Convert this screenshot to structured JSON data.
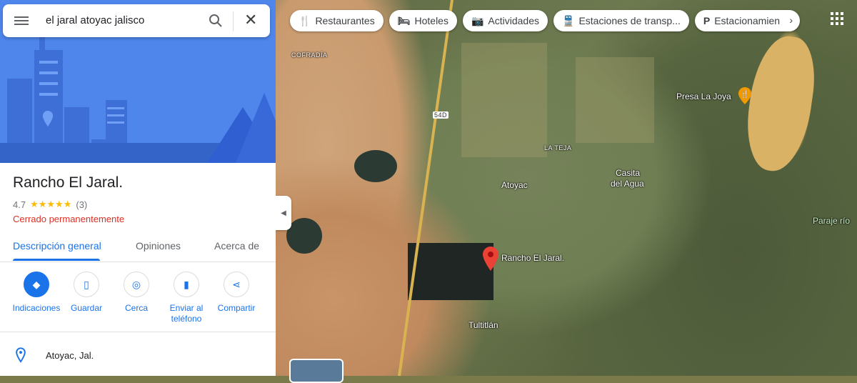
{
  "search": {
    "query": "el jaral atoyac jalisco"
  },
  "place": {
    "title": "Rancho El Jaral.",
    "rating": "4.7",
    "review_count": "(3)",
    "stars": "★★★★★",
    "status": "Cerrado permanentemente",
    "address": "Atoyac, Jal."
  },
  "tabs": [
    {
      "label": "Descripción general"
    },
    {
      "label": "Opiniones"
    },
    {
      "label": "Acerca de"
    }
  ],
  "actions": [
    {
      "label": "Indicaciones",
      "icon": "directions-icon"
    },
    {
      "label": "Guardar",
      "icon": "bookmark-icon"
    },
    {
      "label": "Cerca",
      "icon": "nearby-icon"
    },
    {
      "label": "Enviar al teléfono",
      "icon": "send-to-phone-icon"
    },
    {
      "label": "Compartir",
      "icon": "share-icon"
    }
  ],
  "chips": [
    {
      "label": "Restaurantes",
      "icon": "restaurant-icon"
    },
    {
      "label": "Hoteles",
      "icon": "hotel-icon"
    },
    {
      "label": "Actividades",
      "icon": "camera-icon"
    },
    {
      "label": "Estaciones de transp...",
      "icon": "transit-icon"
    },
    {
      "label": "Estacionamien",
      "icon": "parking-icon"
    }
  ],
  "map_labels": {
    "cofradia": "COFRADÍA",
    "la_teja": "LA TEJA",
    "atoyac": "Atoyac",
    "casita": "Casita",
    "del_agua": "del Agua",
    "presa": "Presa La Joya",
    "paraje": "Paraje río",
    "tultitlan": "Tultitlán",
    "highway": "54D",
    "pin_label": "Rancho El Jaral."
  },
  "colors": {
    "accent": "#1a73e8",
    "closed": "#d93025",
    "star": "#fbbc04",
    "hero": "#4f86ec"
  }
}
